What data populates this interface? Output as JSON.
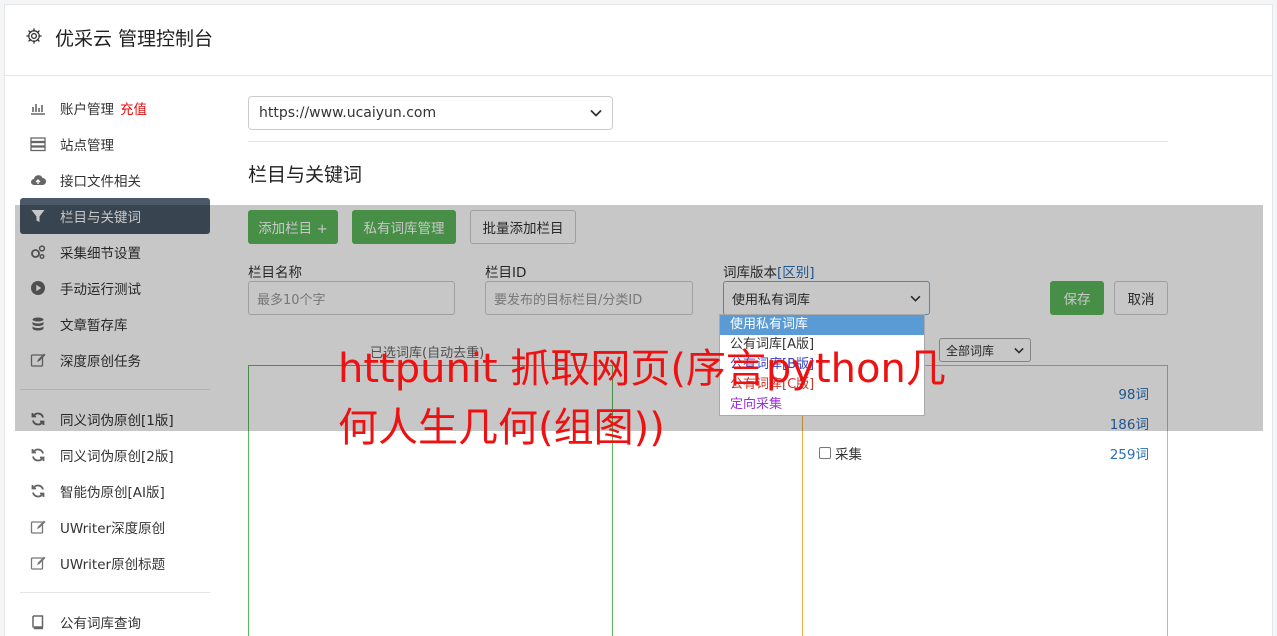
{
  "header": {
    "title": "优采云 管理控制台",
    "icon": "gear-icon"
  },
  "sidebar": {
    "items": [
      {
        "label": "账户管理",
        "badge": "充值",
        "icon": "bar-chart-icon"
      },
      {
        "label": "站点管理",
        "icon": "server-icon"
      },
      {
        "label": "接口文件相关",
        "icon": "cloud-upload-icon"
      },
      {
        "label": "栏目与关键词",
        "icon": "filter-icon",
        "active": true
      },
      {
        "label": "采集细节设置",
        "icon": "gears-icon"
      },
      {
        "label": "手动运行测试",
        "icon": "play-circle-icon"
      },
      {
        "label": "文章暂存库",
        "icon": "database-icon"
      },
      {
        "label": "深度原创任务",
        "icon": "edit-icon"
      },
      {
        "label": "同义词伪原创[1版]",
        "icon": "refresh-icon"
      },
      {
        "label": "同义词伪原创[2版]",
        "icon": "refresh-icon"
      },
      {
        "label": "智能伪原创[AI版]",
        "icon": "refresh-icon"
      },
      {
        "label": "UWriter深度原创",
        "icon": "edit-icon"
      },
      {
        "label": "UWriter原创标题",
        "icon": "edit-icon"
      },
      {
        "label": "公有词库查询",
        "icon": "book-icon"
      }
    ]
  },
  "main": {
    "site_select": "https://www.ucaiyun.com",
    "section_title": "栏目与关键词",
    "buttons": {
      "add_column": "添加栏目 +",
      "private_lib": "私有词库管理",
      "batch_add": "批量添加栏目",
      "save": "保存",
      "cancel": "取消"
    },
    "form": {
      "name_label": "栏目名称",
      "name_placeholder": "最多10个字",
      "id_label": "栏目ID",
      "id_placeholder": "要发布的目标栏目/分类ID",
      "version_label": "词库版本",
      "version_link": "[区别]",
      "version_value": "使用私有词库"
    },
    "dropdown_options": [
      {
        "label": "使用私有词库",
        "color": "#ffffff",
        "selected": true
      },
      {
        "label": "公有词库[A版]",
        "color": "#333333"
      },
      {
        "label": "公有词库[B版]",
        "color": "#3344cc"
      },
      {
        "label": "公有词库[C版]",
        "color": "#c0392b"
      },
      {
        "label": "定向采集",
        "color": "#9b30d9"
      }
    ],
    "selected_panel_title": "已选词库(自动去重)",
    "all_lib_select": "全部词库",
    "lib_rows": [
      {
        "name": "",
        "count": "98词"
      },
      {
        "name": "",
        "count": "186词"
      },
      {
        "name": "采集",
        "count": "259词"
      }
    ]
  },
  "headline": "httpunit 抓取网页(序言python几何人生几何(组图))"
}
